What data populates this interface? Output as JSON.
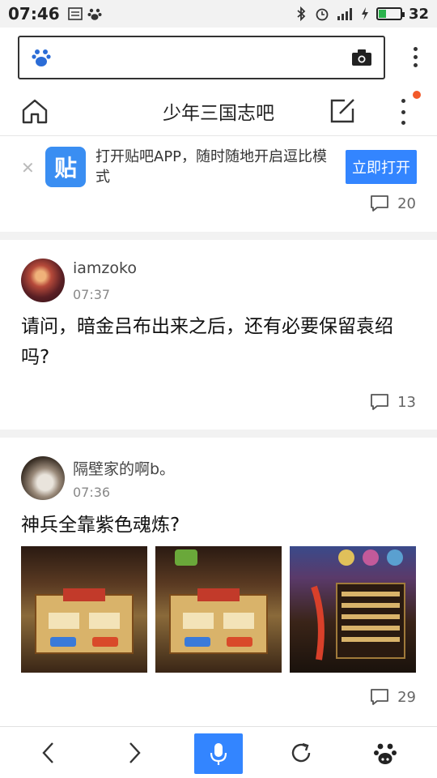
{
  "status_bar": {
    "time": "07:46",
    "battery_percent": "32"
  },
  "forum": {
    "title": "少年三国志吧"
  },
  "banner": {
    "message": "打开贴吧APP，随时随地开启逗比模式",
    "open_label": "立即打开",
    "logo_text": "贴"
  },
  "prev_post": {
    "comment_count": "20"
  },
  "posts": [
    {
      "username": "iamzoko",
      "time": "07:37",
      "text": "请问，暗金吕布出来之后，还有必要保留袁绍吗?",
      "comment_count": "13"
    },
    {
      "username": "隔壁家的啊b。",
      "time": "07:36",
      "text": "神兵全靠紫色魂炼?",
      "comment_count": "29"
    }
  ],
  "colors": {
    "accent": "#3385ff",
    "notify_dot": "#f25a2a"
  }
}
